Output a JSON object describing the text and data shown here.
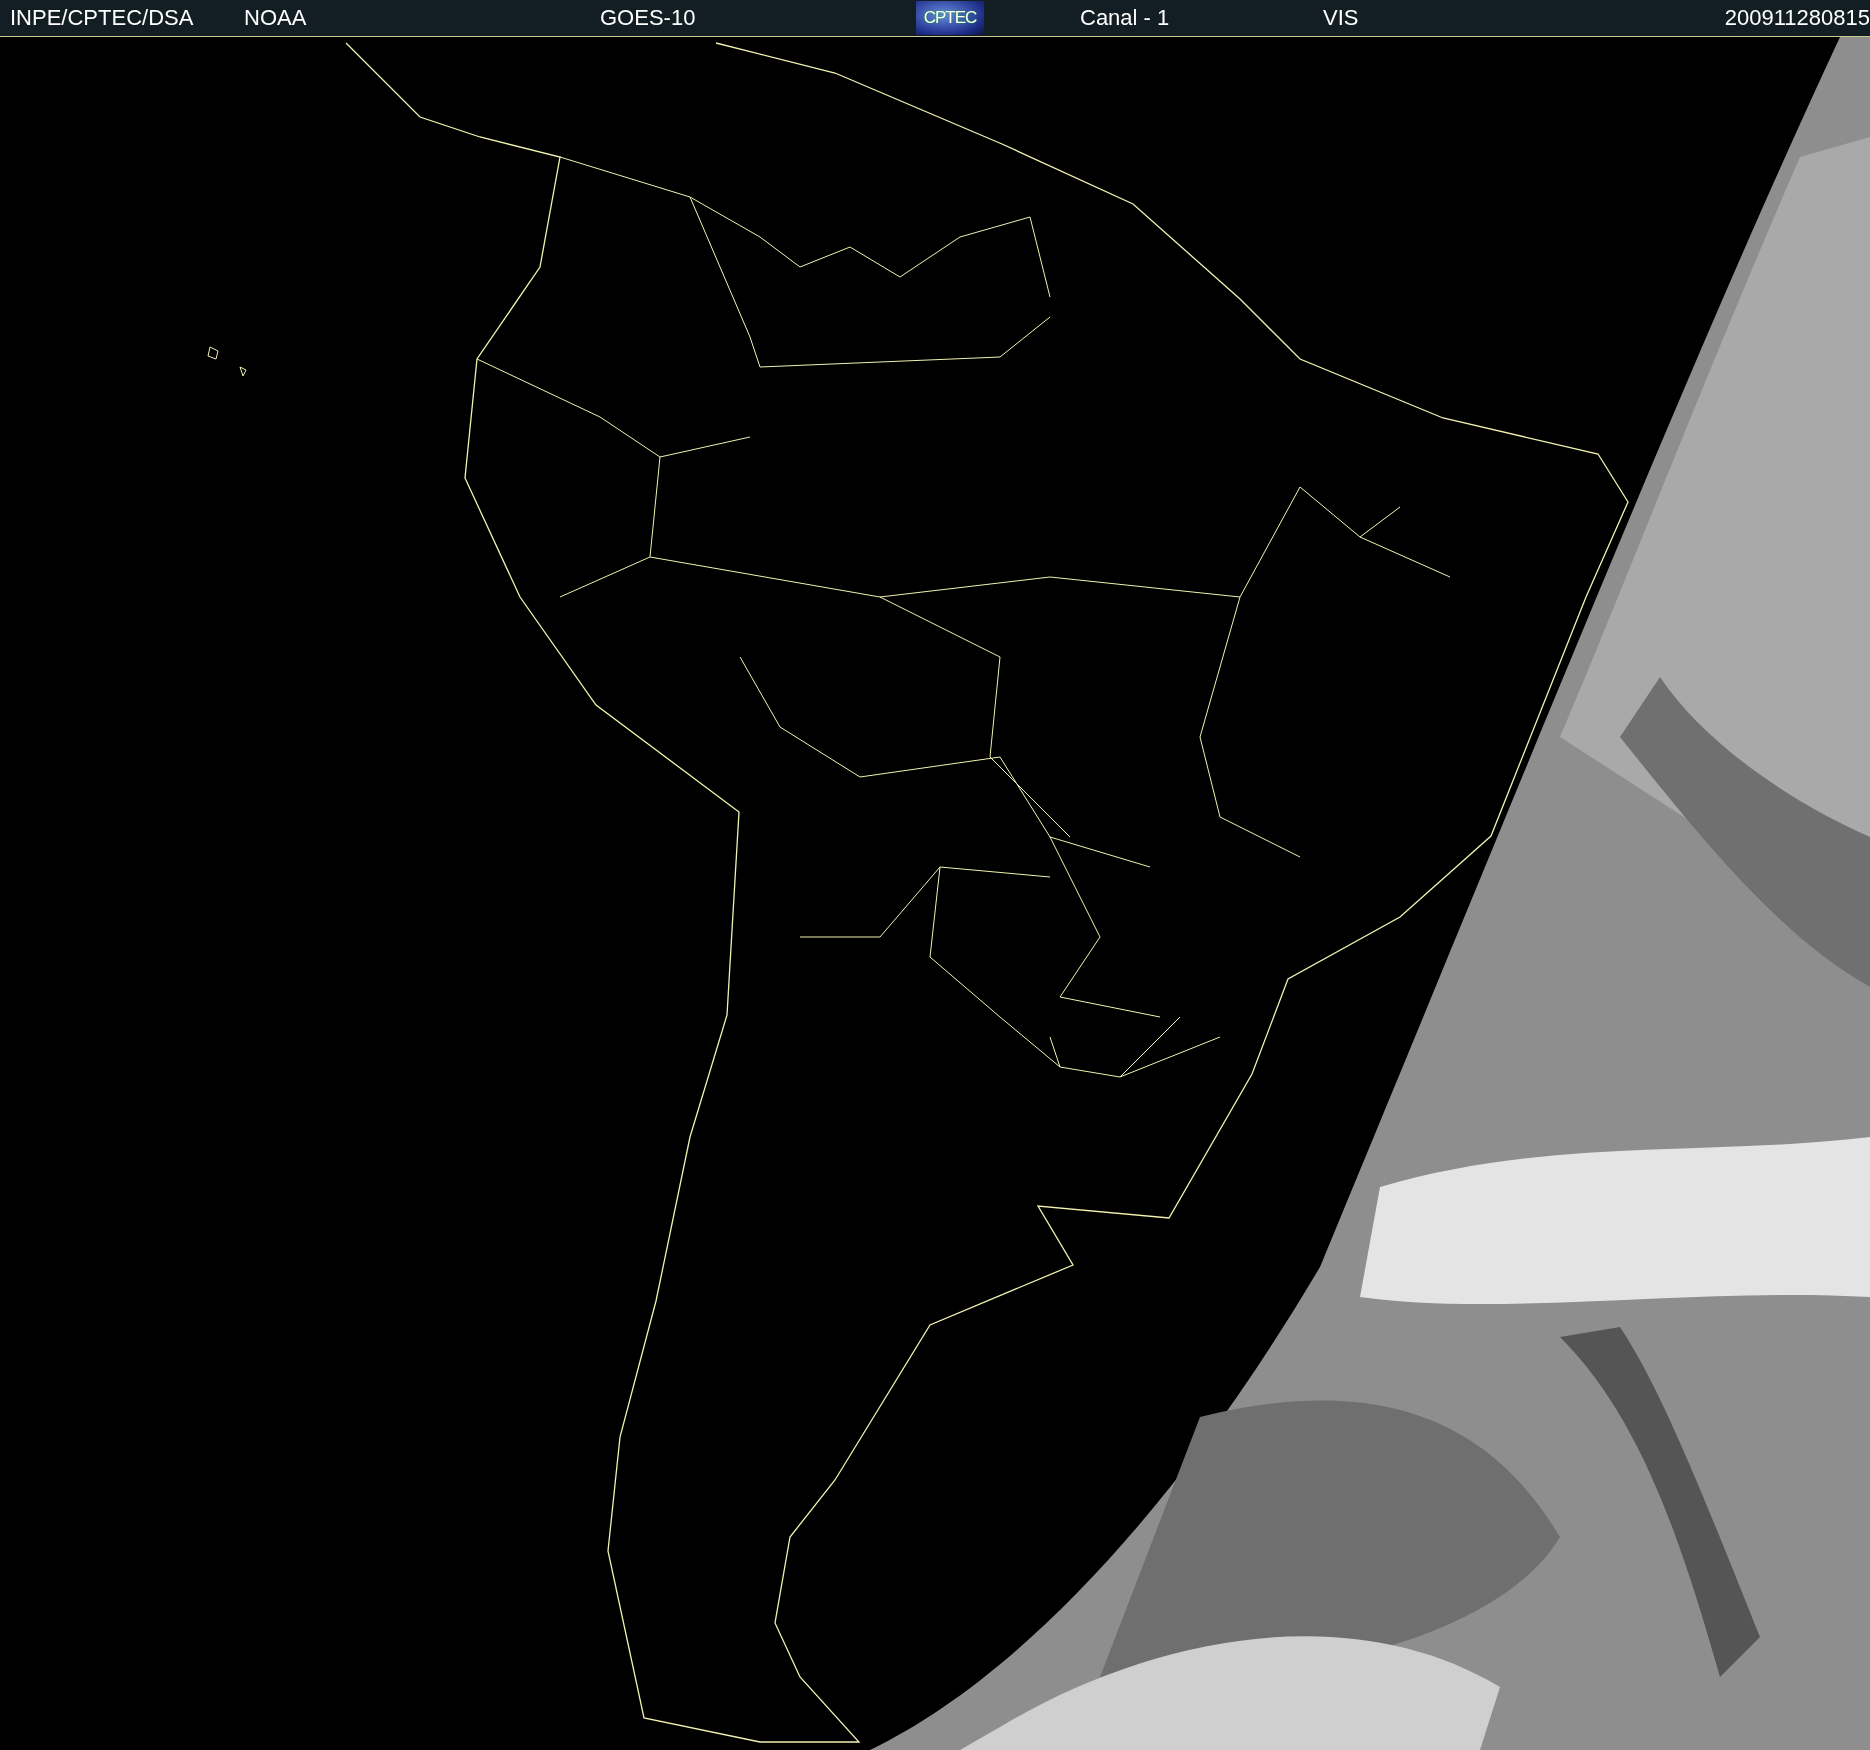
{
  "header": {
    "items": [
      {
        "kind": "text",
        "text": "INPE/CPTEC/DSA"
      },
      {
        "kind": "text",
        "text": "NOAA"
      },
      {
        "kind": "text",
        "text": "GOES-10"
      },
      {
        "kind": "logo",
        "text": "CPTEC"
      },
      {
        "kind": "text",
        "text": "Canal - 1"
      },
      {
        "kind": "text",
        "text": "VIS"
      },
      {
        "kind": "text",
        "text": "200911280815"
      }
    ]
  }
}
